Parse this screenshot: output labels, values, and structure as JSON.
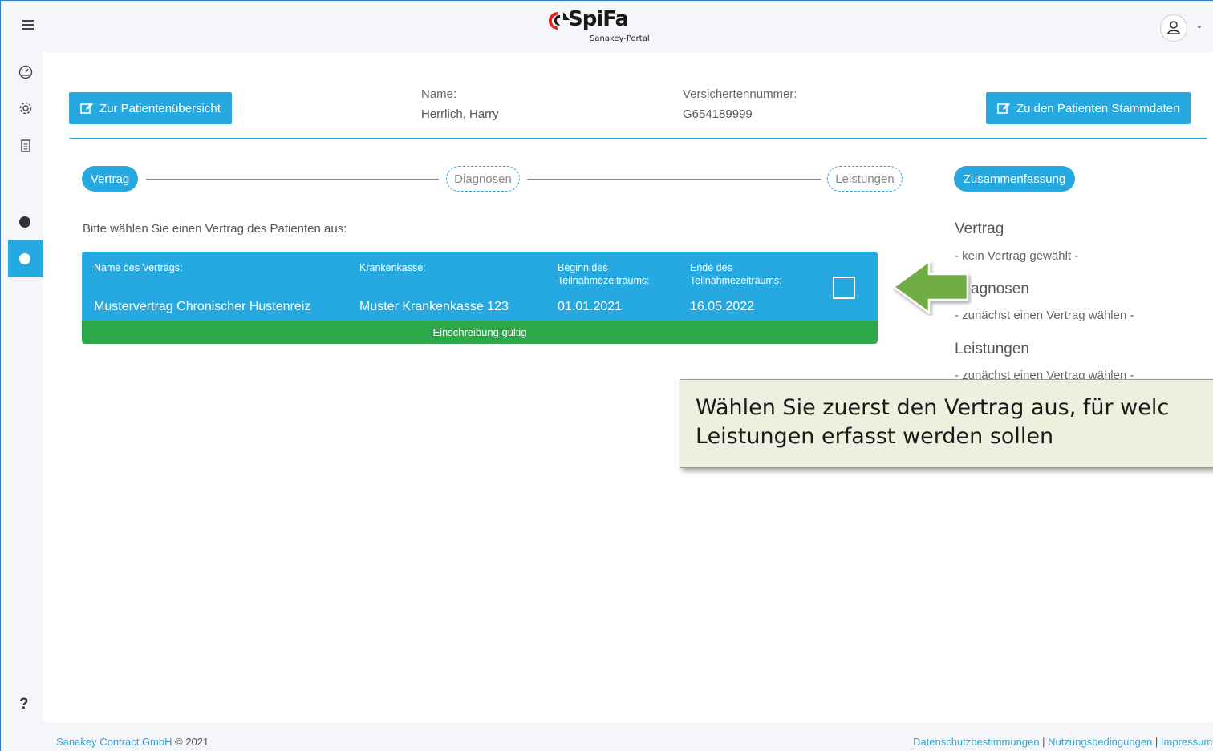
{
  "app": {
    "logo_text": "SpiFa",
    "logo_subtext": "Sanakey-Portal"
  },
  "header": {
    "btn_overview": "Zur Patientenübersicht",
    "name_label": "Name:",
    "name_value": "Herrlich, Harry",
    "insurance_label": "Versichertennummer:",
    "insurance_value": "G654189999",
    "btn_master_data": "Zu den Patienten Stammdaten"
  },
  "stepper": {
    "steps": [
      "Vertrag",
      "Diagnosen",
      "Leistungen"
    ],
    "summary": "Zusammenfassung",
    "active_step": "Vertrag"
  },
  "instruction": "Bitte wählen Sie einen Vertrag des Patienten aus:",
  "contract_table": {
    "headers": [
      "Name des Vertrags:",
      "Krankenkasse:",
      "Beginn des Teilnahmezeitraums:",
      "Ende des Teilnahmezeitraums:"
    ],
    "row": {
      "name": "Mustervertrag Chronischer Hustenreiz",
      "insurer": "Muster Krankenkasse 123",
      "start": "01.01.2021",
      "end": "16.05.2022",
      "selected": false
    },
    "status": "Einschreibung gültig"
  },
  "summary": {
    "contract_heading": "Vertrag",
    "contract_text": "- kein Vertrag gewählt -",
    "diag_heading": "agnosen",
    "diag_text": "- zunächst einen Vertrag wählen -",
    "services_heading": "Leistungen",
    "services_text": "- zunächst einen Vertrag wählen -"
  },
  "tooltip": {
    "line1": "Wählen Sie zuerst den Vertrag aus, für welc",
    "line2": "Leistungen erfasst werden sollen"
  },
  "footer": {
    "company": "Sanakey Contract GmbH",
    "copyright": "© 2021",
    "links": [
      "Datenschutzbestimmungen",
      "Nutzungsbedingungen",
      "Impressum"
    ],
    "separator": "|"
  },
  "colors": {
    "accent": "#25a9e0",
    "success": "#2ca84a",
    "tooltip_bg": "#ebf1de",
    "arrow": "#70ad47"
  },
  "icons": {
    "menu": "hamburger-icon",
    "user": "user-icon",
    "dashboard": "gauge-icon",
    "settings": "gear-icon",
    "document": "document-icon",
    "edit": "edit-icon",
    "help": "question-icon",
    "logout": "logout-icon"
  }
}
